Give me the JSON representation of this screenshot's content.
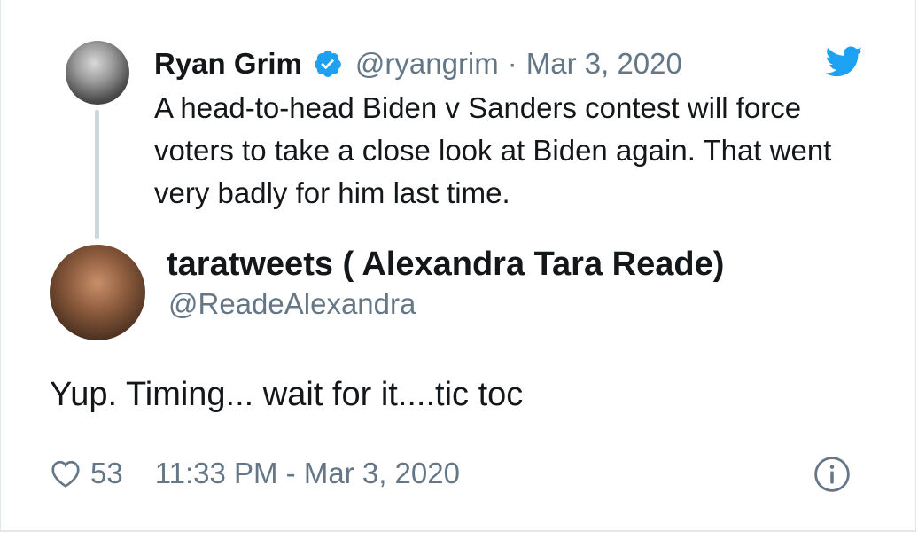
{
  "quoted_tweet": {
    "author_name": "Ryan Grim",
    "handle": "@ryangrim",
    "separator": "·",
    "date": "Mar 3, 2020",
    "text": "A head-to-head Biden v Sanders contest will force voters to take a close look at Biden again. That went very badly for him last time.",
    "verified_icon": "verified-badge-icon",
    "source_icon": "twitter-bird-icon"
  },
  "reply_tweet": {
    "author_name": "taratweets ( Alexandra Tara Reade)",
    "handle": "@ReadeAlexandra",
    "text": "Yup. Timing... wait for it....tic toc",
    "like_count": "53",
    "timestamp": "11:33 PM - Mar 3, 2020",
    "like_icon": "heart-icon",
    "info_icon": "info-icon"
  },
  "colors": {
    "primary_text": "#14171a",
    "secondary_text": "#657786",
    "twitter_blue": "#1da1f2",
    "thread_line": "#ccd6dd",
    "border": "#e1e8ed"
  }
}
